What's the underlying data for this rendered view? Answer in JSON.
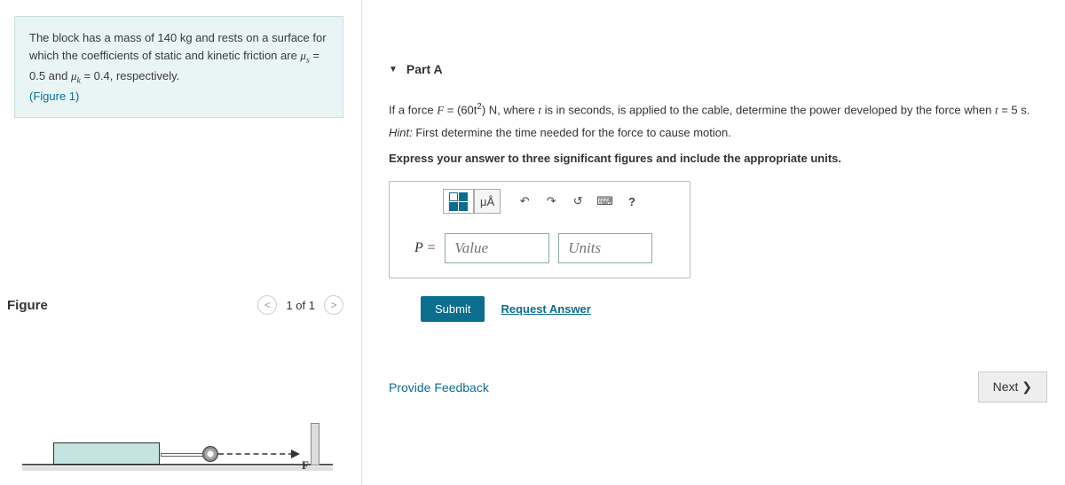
{
  "left": {
    "intro_html": "The block has a mass of 140 kg and rests on a surface for which the coefficients of static and kinetic friction are <span class='serif-i'>μ<sub>s</sub></span> = 0.5 and <span class='serif-i'>μ<sub>k</sub></span> = 0.4, respectively.",
    "figure_link": "(Figure 1)",
    "figure_title": "Figure",
    "nav_count": "1 of 1",
    "arrow_label": "F"
  },
  "right": {
    "part_label": "Part A",
    "question_html": "If a force <span class='serif-i'>F</span> = (60t<sup>2</sup>) N, where <span class='serif-i'>t</span> is in seconds, is applied to the cable, determine the power developed by the force when <span class='serif-i'>t</span> = 5 s.",
    "hint_html": "<em>Hint:</em> First determine the time needed for the force to cause motion.",
    "express": "Express your answer to three significant figures and include the appropriate units.",
    "toolbar": {
      "units_symbol": "μÅ",
      "help": "?"
    },
    "eq_label": "P =",
    "value_placeholder": "Value",
    "units_placeholder": "Units",
    "submit": "Submit",
    "request": "Request Answer",
    "feedback": "Provide Feedback",
    "next": "Next ❯"
  }
}
